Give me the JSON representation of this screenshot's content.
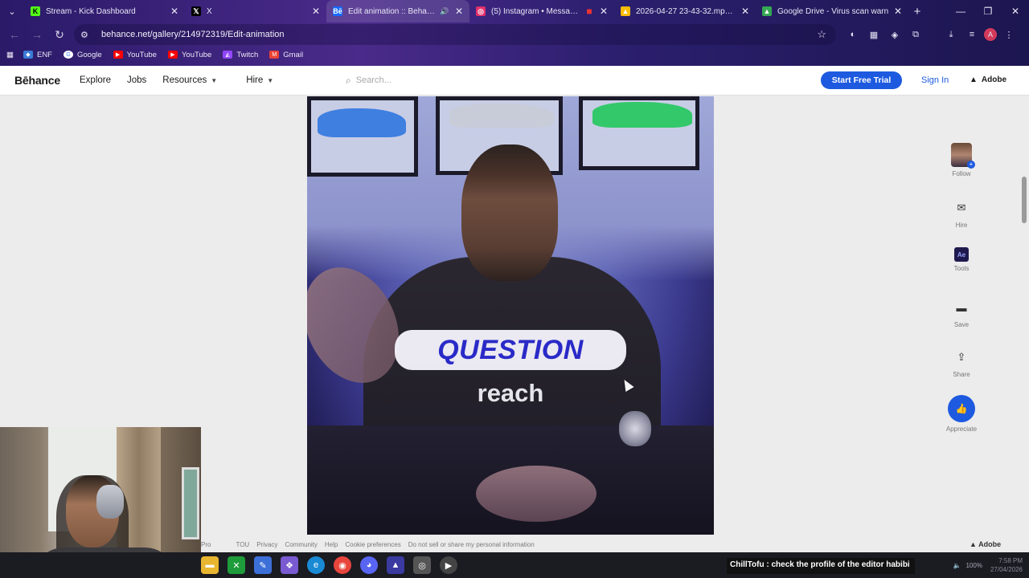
{
  "browser": {
    "tabs": [
      {
        "title": "Stream - Kick Dashboard",
        "icon": "kick-icon",
        "color": "#53fc18"
      },
      {
        "title": "X",
        "icon": "x-icon",
        "color": "#000000"
      },
      {
        "title": "Edit animation :: Behance",
        "icon": "behance-icon",
        "color": "#1769ff"
      },
      {
        "title": "(5) Instagram • Messages",
        "icon": "instagram-icon",
        "color": "#e1306c"
      },
      {
        "title": "2026-04-27 23-43-32.mp4 - Go",
        "icon": "drive-icon",
        "color": "#fbbc04"
      },
      {
        "title": "Google Drive - Virus scan warn",
        "icon": "drive-icon",
        "color": "#34a853"
      }
    ],
    "url": "behance.net/gallery/214972319/Edit-animation",
    "bookmarks": [
      {
        "label": "ENF",
        "icon": "enf-icon",
        "color": "#3a7bd5"
      },
      {
        "label": "Google",
        "icon": "google-icon",
        "color": "#ffffff"
      },
      {
        "label": "YouTube",
        "icon": "youtube-icon",
        "color": "#ff0000"
      },
      {
        "label": "YouTube",
        "icon": "youtube-icon",
        "color": "#ff0000"
      },
      {
        "label": "Twitch",
        "icon": "twitch-icon",
        "color": "#9146ff"
      },
      {
        "label": "Gmail",
        "icon": "gmail-icon",
        "color": "#ea4335"
      }
    ],
    "profile_initial": "A"
  },
  "header": {
    "logo": "Bēhance",
    "nav": {
      "explore": "Explore",
      "jobs": "Jobs",
      "resources": "Resources",
      "hire": "Hire"
    },
    "search_placeholder": "Search...",
    "start_trial": "Start Free Trial",
    "sign_in": "Sign In",
    "adobe": "Adobe"
  },
  "media": {
    "caption_main": "QUESTION",
    "caption_sub": "reach"
  },
  "rail": {
    "follow": "Follow",
    "hire": "Hire",
    "tools": "Tools",
    "tools_badge": "Ae",
    "save": "Save",
    "share": "Share",
    "appreciate": "Appreciate"
  },
  "footer": {
    "links": [
      "Pro",
      "TOU",
      "Privacy",
      "Community",
      "Help",
      "Cookie preferences",
      "Do not sell or share my personal information"
    ],
    "adobe": "Adobe"
  },
  "overlay": {
    "chat_message": "ChillTofu : check the profile of the editor habibi"
  },
  "taskbar": {
    "battery": "100%",
    "time": "7:58 PM",
    "date": "27/04/2026"
  },
  "colors": {
    "accent": "#1d5ae0",
    "caption_text": "#2a2ac8"
  }
}
